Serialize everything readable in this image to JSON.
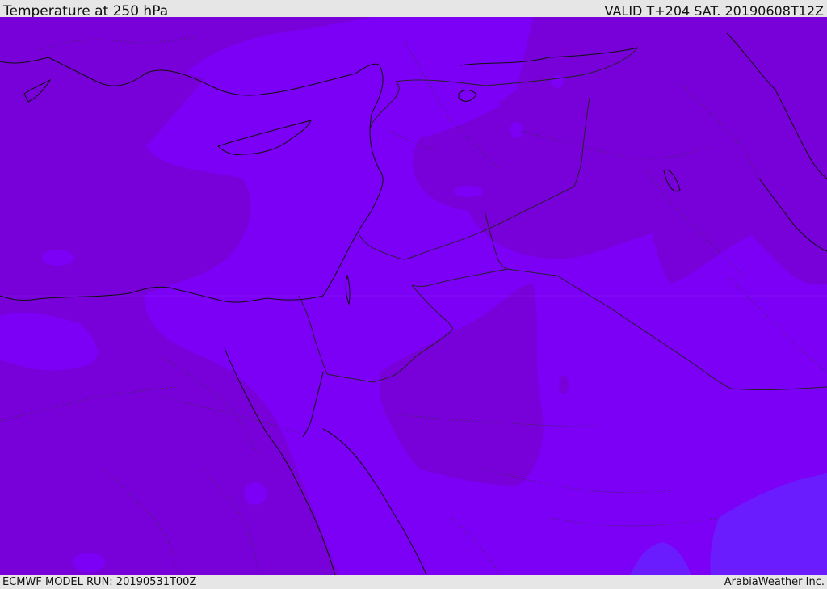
{
  "header": {
    "title": "Temperature at 250 hPa",
    "valid": "VALID T+204 SAT. 20190608T12Z"
  },
  "footer": {
    "model_run": "ECMWF MODEL RUN: 20190531T00Z",
    "credit": "ArabiaWeather Inc."
  },
  "colors": {
    "dark_purple": "#7800d8",
    "mid_purple": "#7c00f6",
    "blue_violet": "#6a1cff",
    "coast": "#111111",
    "border": "#222222"
  }
}
